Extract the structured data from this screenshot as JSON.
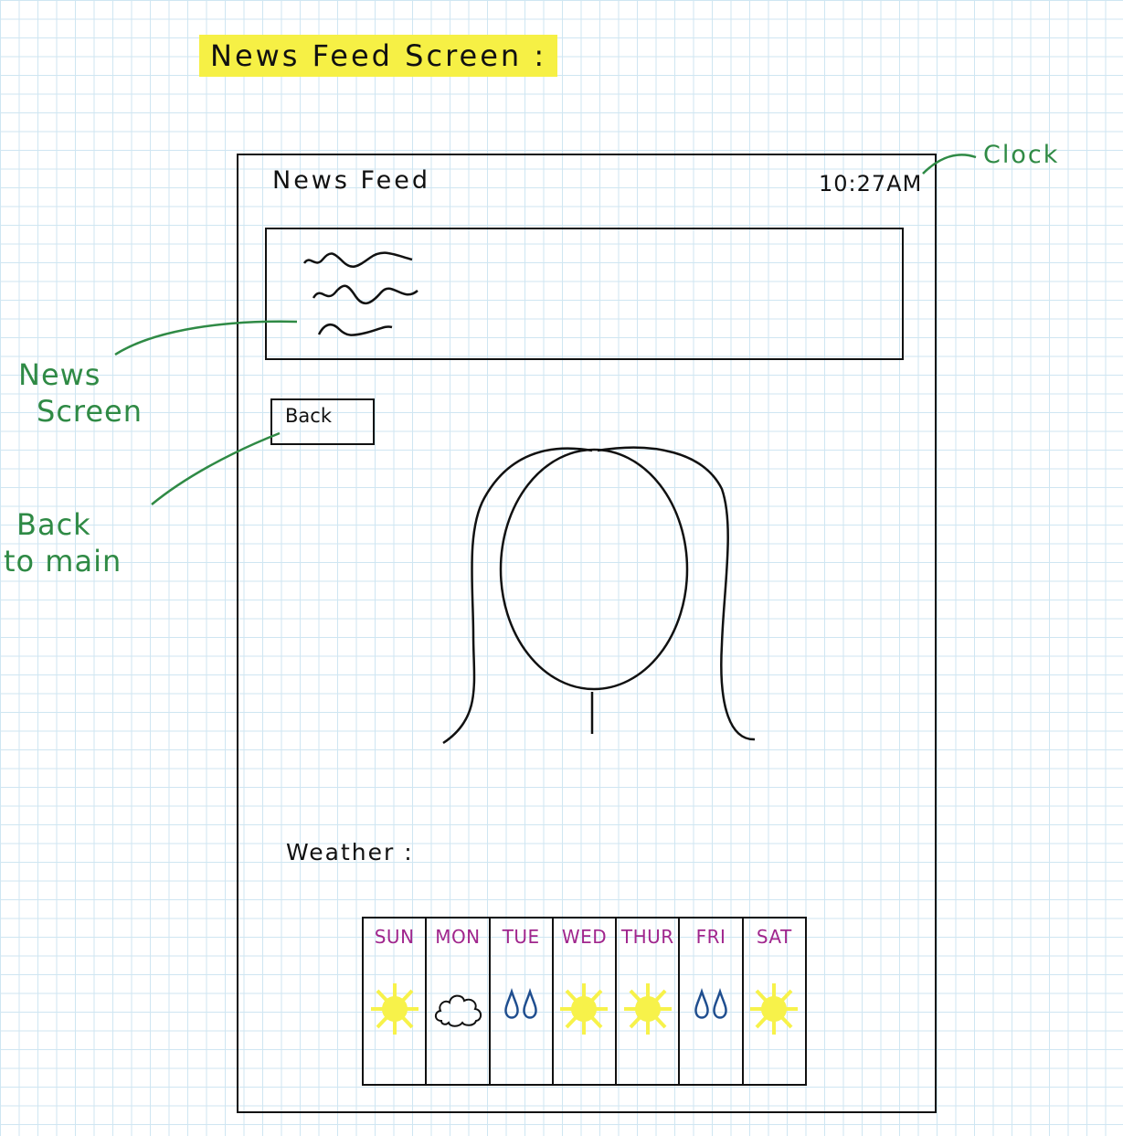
{
  "page_title": "News Feed Screen :",
  "screen": {
    "title": "News Feed",
    "clock": "10:27AM",
    "back_button": "Back",
    "weather_label": "Weather :"
  },
  "weather": [
    {
      "day": "SUN",
      "icon": "sun-icon"
    },
    {
      "day": "MON",
      "icon": "cloud-icon"
    },
    {
      "day": "TUE",
      "icon": "rain-icon"
    },
    {
      "day": "WED",
      "icon": "sun-icon"
    },
    {
      "day": "THUR",
      "icon": "sun-icon"
    },
    {
      "day": "FRI",
      "icon": "rain-icon"
    },
    {
      "day": "SAT",
      "icon": "sun-icon"
    }
  ],
  "annotations": {
    "clock": "Clock",
    "news_line1": "News",
    "news_line2": "Screen",
    "back_line1": "Back",
    "back_line2": "to main"
  },
  "colors": {
    "annotation": "#2f8a45",
    "day_label": "#a0268d",
    "sun": "#f7f24a",
    "rain": "#1f4e8f",
    "highlight": "#f6f045"
  }
}
